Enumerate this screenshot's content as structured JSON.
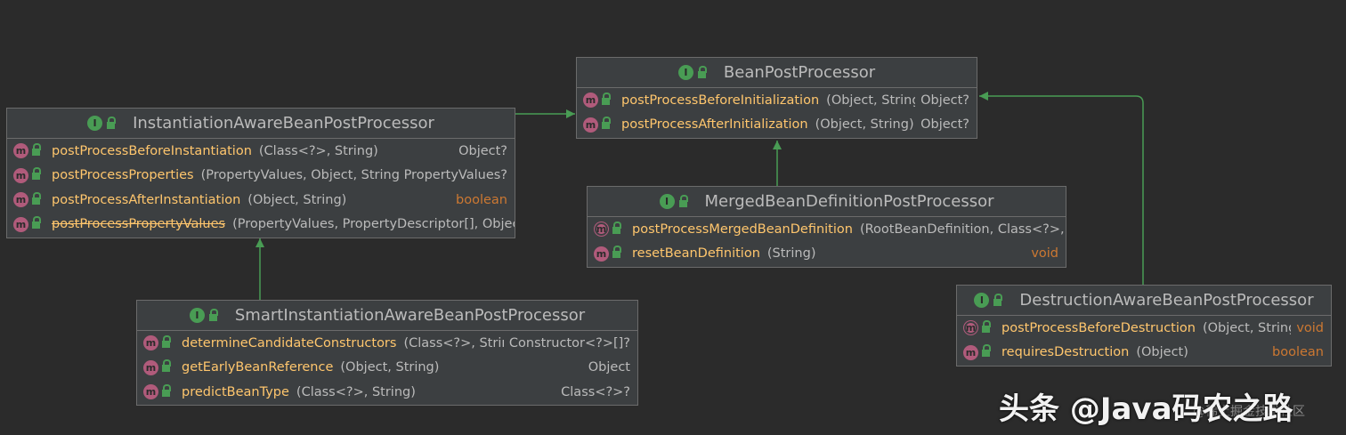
{
  "colors": {
    "background": "#2b2b2b",
    "box": "#3c3f41",
    "interface_badge": "#499c54",
    "method_badge": "#b05b7b",
    "method_name": "#ffc66d",
    "keyword": "#cc7832",
    "edge": "#499c54"
  },
  "icons": {
    "interface": "I",
    "method": "m"
  },
  "classes": {
    "bpp": {
      "name": "BeanPostProcessor",
      "methods": [
        {
          "name": "postProcessBeforeInitialization",
          "params": "(Object, String)",
          "ret": "Object?"
        },
        {
          "name": "postProcessAfterInitialization",
          "params": "(Object, String)",
          "ret": "Object?"
        }
      ]
    },
    "iabpp": {
      "name": "InstantiationAwareBeanPostProcessor",
      "methods": [
        {
          "name": "postProcessBeforeInstantiation",
          "params": "(Class<?>, String)",
          "ret": "Object?"
        },
        {
          "name": "postProcessProperties",
          "params": "(PropertyValues, Object, String)",
          "ret": "PropertyValues?"
        },
        {
          "name": "postProcessAfterInstantiation",
          "params": "(Object, String)",
          "ret": "boolean"
        },
        {
          "name": "postProcessPropertyValues",
          "params": "(PropertyValues, PropertyDescriptor[], Object,",
          "ret": ""
        }
      ]
    },
    "mbdpp": {
      "name": "MergedBeanDefinitionPostProcessor",
      "methods": [
        {
          "name": "postProcessMergedBeanDefinition",
          "params": "(RootBeanDefinition, Class<?>, St",
          "ret": ""
        },
        {
          "name": "resetBeanDefinition",
          "params": "(String)",
          "ret": "void"
        }
      ]
    },
    "siabpp": {
      "name": "SmartInstantiationAwareBeanPostProcessor",
      "methods": [
        {
          "name": "determineCandidateConstructors",
          "params": "(Class<?>, String)",
          "ret": "Constructor<?>[]?"
        },
        {
          "name": "getEarlyBeanReference",
          "params": "(Object, String)",
          "ret": "Object"
        },
        {
          "name": "predictBeanType",
          "params": "(Class<?>, String)",
          "ret": "Class<?>?"
        }
      ]
    },
    "dabpp": {
      "name": "DestructionAwareBeanPostProcessor",
      "methods": [
        {
          "name": "postProcessBeforeDestruction",
          "params": "(Object, String)",
          "ret": "void"
        },
        {
          "name": "requiresDestruction",
          "params": "(Object)",
          "ret": "boolean"
        }
      ]
    }
  },
  "watermark": {
    "main": "头条 @Java码农之路",
    "sub": "@稀土掘金技术社区"
  }
}
